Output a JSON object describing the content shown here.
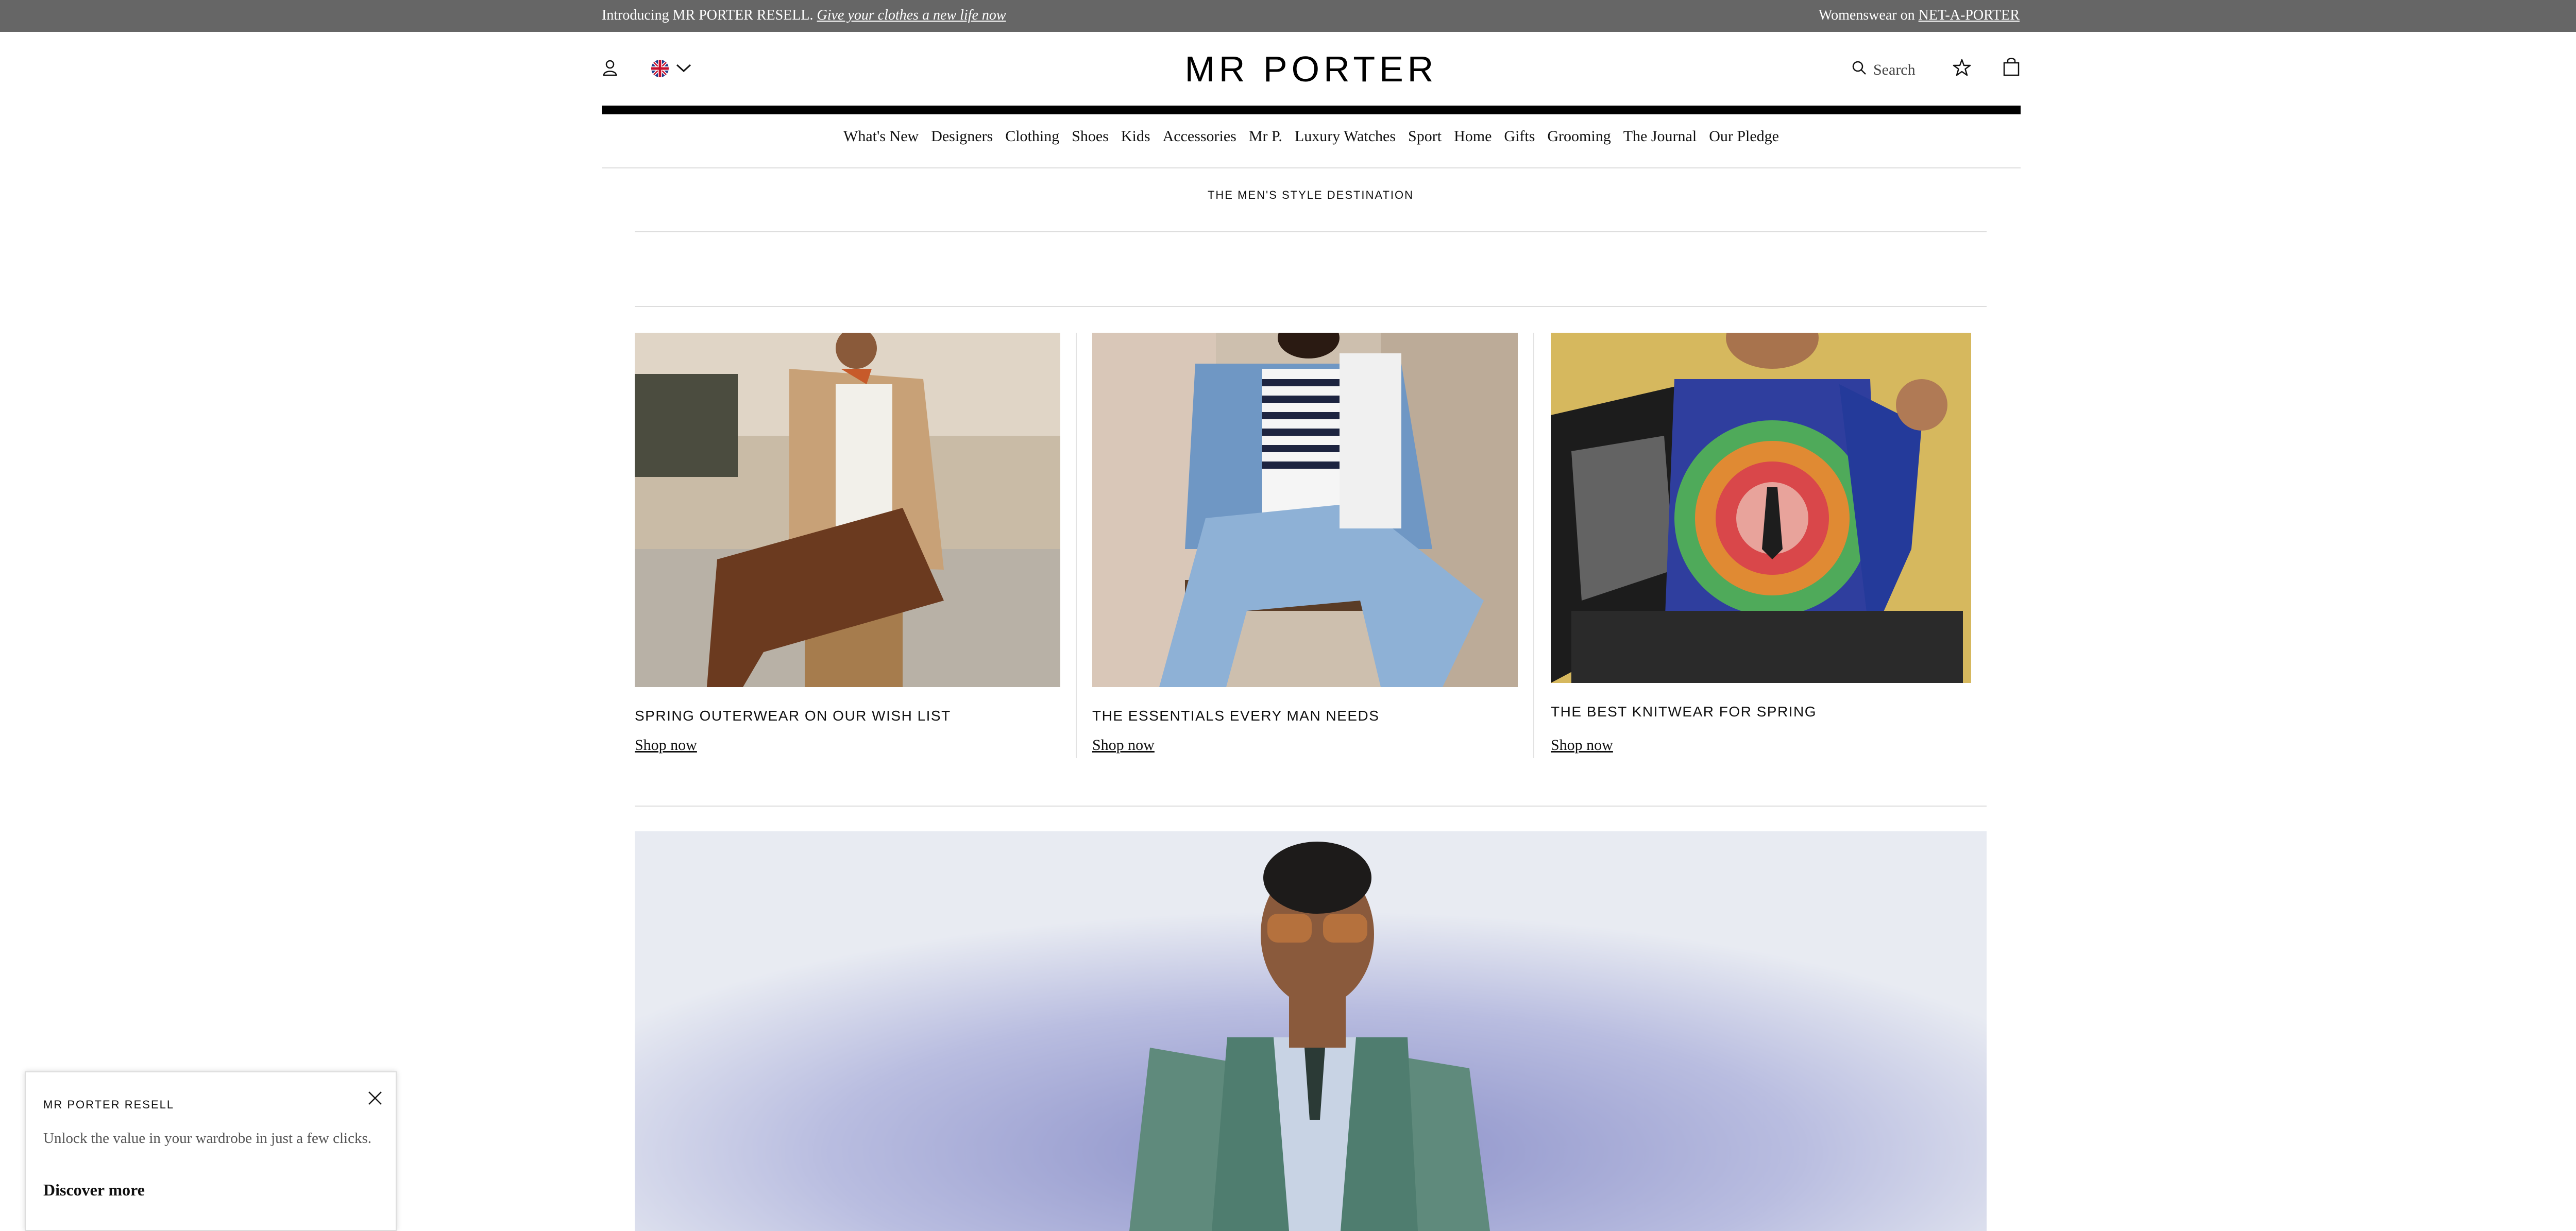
{
  "promo_bar": {
    "intro": "Introducing MR PORTER RESELL.",
    "intro_link": "Give your clothes a new life now",
    "womenswear_prefix": "Womenswear on",
    "womenswear_link": "NET-A-PORTER"
  },
  "header": {
    "logo": "MR PORTER",
    "search_label": "Search"
  },
  "nav": {
    "items": [
      "What's New",
      "Designers",
      "Clothing",
      "Shoes",
      "Kids",
      "Accessories",
      "Mr P.",
      "Luxury Watches",
      "Sport",
      "Home",
      "Gifts",
      "Grooming",
      "The Journal",
      "Our Pledge"
    ]
  },
  "tagline": "THE MEN'S STYLE DESTINATION",
  "tiles": [
    {
      "title": "SPRING OUTERWEAR ON OUR WISH LIST",
      "cta": "Shop now"
    },
    {
      "title": "THE ESSENTIALS EVERY MAN NEEDS",
      "cta": "Shop now"
    },
    {
      "title": "THE BEST KNITWEAR FOR SPRING",
      "cta": "Shop now"
    }
  ],
  "popup": {
    "title": "MR PORTER RESELL",
    "body": "Unlock the value in your wardrobe in just a few clicks.",
    "cta": "Discover more"
  },
  "colors": {
    "promo_bg": "#666666",
    "text": "#111111",
    "rule": "#dddddd"
  },
  "icons": [
    "account-icon",
    "uk-flag-icon",
    "chevron-down-icon",
    "search-icon",
    "star-icon",
    "bag-icon",
    "close-icon"
  ]
}
